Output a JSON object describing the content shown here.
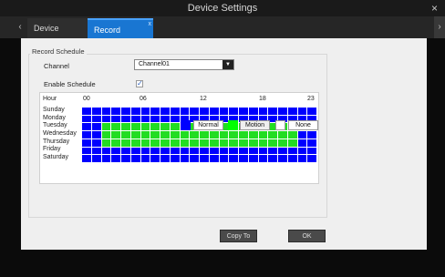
{
  "window": {
    "title": "Device Settings",
    "close_icon": "×"
  },
  "tabs": [
    {
      "label": "Device Settings",
      "active": false
    },
    {
      "label": "Record Schedule",
      "active": true
    }
  ],
  "form": {
    "section_title": "Record Schedule",
    "channel_label": "Channel",
    "channel_value": "Channel01",
    "enable_label": "Enable Schedule",
    "enable_checked": true
  },
  "schedule": {
    "hours": [
      {
        "text": "Hour"
      },
      {
        "text": "00"
      },
      {
        "text": "06"
      },
      {
        "text": "12"
      },
      {
        "text": "18"
      },
      {
        "text": "23"
      }
    ],
    "days": [
      "Sunday",
      "Monday",
      "Tuesday",
      "Wednesday",
      "Thursday",
      "Friday",
      "Saturday"
    ],
    "rows": [
      [
        "N",
        "N",
        "N",
        "N",
        "N",
        "N",
        "N",
        "N",
        "N",
        "N",
        "N",
        "N",
        "N",
        "N",
        "N",
        "N",
        "N",
        "N",
        "N",
        "N",
        "N",
        "N",
        "N",
        "N"
      ],
      [
        "N",
        "N",
        "N",
        "N",
        "N",
        "N",
        "N",
        "N",
        "N",
        "N",
        "N",
        "N",
        "N",
        "N",
        "N",
        "N",
        "N",
        "N",
        "N",
        "N",
        "N",
        "N",
        "N",
        "N"
      ],
      [
        "N",
        "N",
        "M",
        "M",
        "M",
        "M",
        "M",
        "M",
        "M",
        "M",
        "M",
        "M",
        "M",
        "M",
        "M",
        "M",
        "M",
        "M",
        "M",
        "M",
        "M",
        "M",
        "N",
        "N"
      ],
      [
        "N",
        "N",
        "M",
        "M",
        "M",
        "M",
        "M",
        "M",
        "M",
        "M",
        "M",
        "M",
        "M",
        "M",
        "M",
        "M",
        "M",
        "M",
        "M",
        "M",
        "M",
        "M",
        "N",
        "N"
      ],
      [
        "N",
        "N",
        "M",
        "M",
        "M",
        "M",
        "M",
        "M",
        "M",
        "M",
        "M",
        "M",
        "M",
        "M",
        "M",
        "M",
        "M",
        "M",
        "M",
        "M",
        "M",
        "M",
        "N",
        "N"
      ],
      [
        "N",
        "N",
        "N",
        "N",
        "N",
        "N",
        "N",
        "N",
        "N",
        "N",
        "N",
        "N",
        "N",
        "N",
        "N",
        "N",
        "N",
        "N",
        "N",
        "N",
        "N",
        "N",
        "N",
        "N"
      ],
      [
        "N",
        "N",
        "N",
        "N",
        "N",
        "N",
        "N",
        "N",
        "N",
        "N",
        "N",
        "N",
        "N",
        "N",
        "N",
        "N",
        "N",
        "N",
        "N",
        "N",
        "N",
        "N",
        "N",
        "N"
      ]
    ],
    "legend": [
      {
        "label": "Normal",
        "color": "#0000ff"
      },
      {
        "label": "Motion",
        "color": "#00ff00"
      },
      {
        "label": "None",
        "color": "#ffffff"
      }
    ]
  },
  "buttons": {
    "copy_to": "Copy To",
    "ok": "OK"
  },
  "colors": {
    "normal": "#0000ff",
    "motion": "#22dd22",
    "none": "#ffffff",
    "tab_active": "#1976d2"
  }
}
